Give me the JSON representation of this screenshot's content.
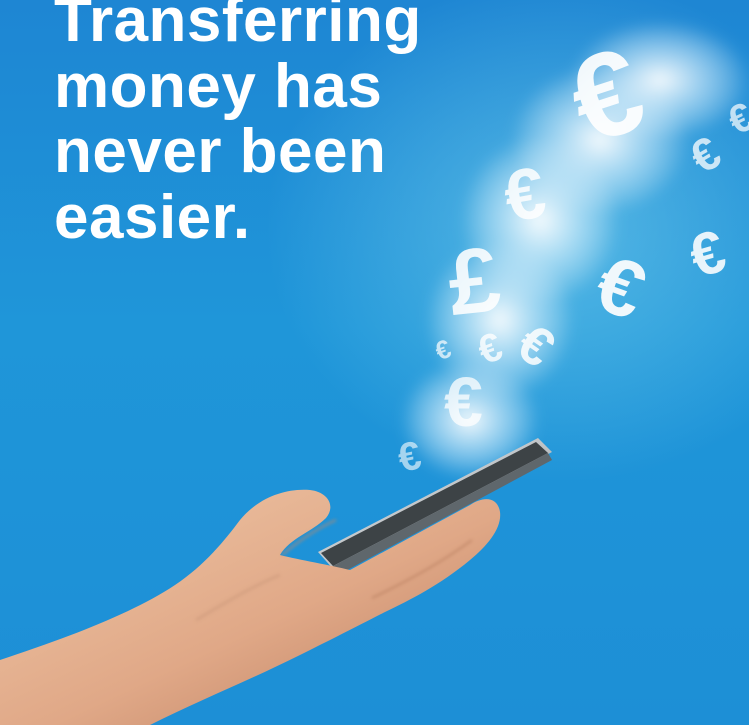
{
  "headline": {
    "line1": "Transferring",
    "line2": "money has",
    "line3": "never been",
    "line4": "easier."
  },
  "image": {
    "subject": "hand holding smartphone emitting currency symbols",
    "symbol_euro": "€",
    "symbol_pound": "£"
  },
  "colors": {
    "background_top": "#1e86d3",
    "background_bottom": "#1d8fd6",
    "text": "#ffffff"
  }
}
